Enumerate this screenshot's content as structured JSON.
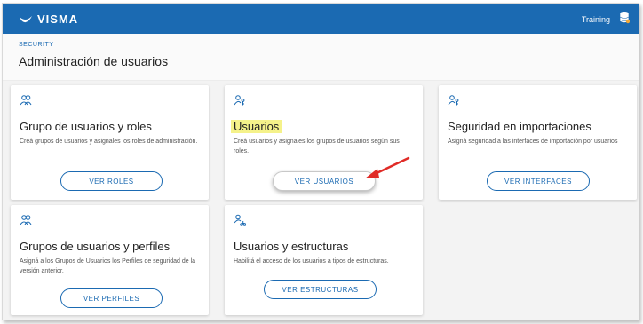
{
  "topbar": {
    "logo_text": "VISMA",
    "environment_label": "Training"
  },
  "header": {
    "breadcrumb": "SECURITY",
    "title": "Administración de usuarios"
  },
  "cards": [
    {
      "title": "Grupo de usuarios y roles",
      "description": "Creá grupos de usuarios y asignales los roles de administración.",
      "button": "VER ROLES"
    },
    {
      "title": "Usuarios",
      "description": "Creá usuarios y asignales los grupos de usuarios según sus roles.",
      "button": "VER USUARIOS"
    },
    {
      "title": "Seguridad en importaciones",
      "description": "Asigná seguridad a las interfaces de importación por usuarios",
      "button": "VER INTERFACES"
    },
    {
      "title": "Grupos de usuarios y perfiles",
      "description": "Asigná a los Grupos de Usuarios los Perfiles de seguridad de la versión anterior.",
      "button": "VER PERFILES"
    },
    {
      "title": "Usuarios y estructuras",
      "description": "Habilitá el acceso de los usuarios a tipos de estructuras.",
      "button": "VER ESTRUCTURAS"
    }
  ],
  "colors": {
    "brand": "#1b6ab2",
    "highlight": "#f5f28a",
    "annotation_arrow": "#e02b27"
  }
}
